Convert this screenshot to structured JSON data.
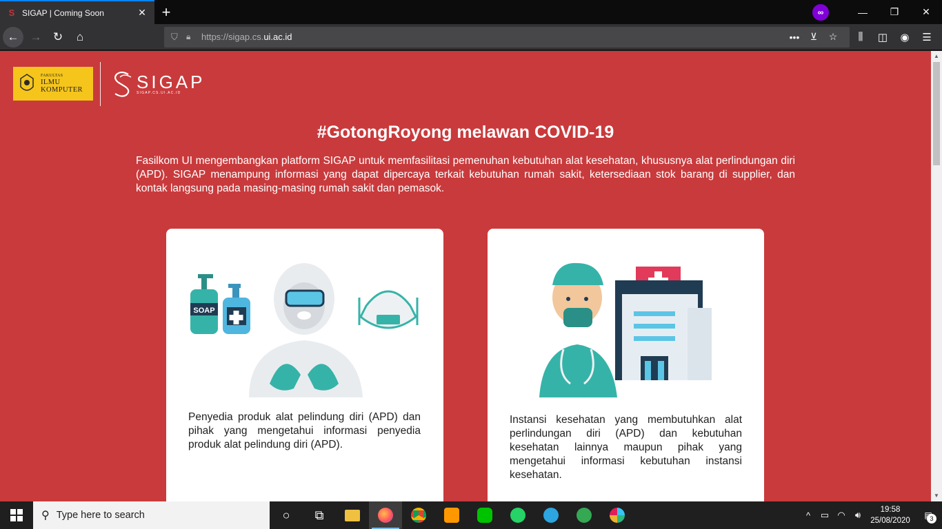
{
  "browser": {
    "tab_title": "SIGAP | Coming Soon",
    "url_prefix": "https://sigap.cs.",
    "url_domain": "ui.ac.id"
  },
  "logos": {
    "fasilkom_small": "FAKULTAS",
    "fasilkom_line1": "ILMU",
    "fasilkom_line2": "KOMPUTER",
    "sigap_word": "SIGAP",
    "sigap_sub": "SIGAP.CS.UI.AC.ID"
  },
  "main": {
    "headline": "#GotongRoyong melawan COVID-19",
    "intro": "Fasilkom UI mengembangkan platform SIGAP untuk memfasilitasi pemenuhan kebutuhan alat kesehatan, khususnya alat perlindungan diri (APD). SIGAP menampung informasi yang dapat dipercaya terkait kebutuhan rumah sakit, ketersediaan stok barang di supplier, dan kontak langsung pada masing-masing rumah sakit dan pemasok.",
    "cards": [
      {
        "text": "Penyedia produk alat pelindung diri (APD) dan pihak yang mengetahui informasi penyedia produk alat pelindung diri (APD)."
      },
      {
        "text": "Instansi kesehatan yang membutuhkan alat perlindungan diri (APD) dan kebutuhan kesehatan lainnya maupun pihak yang mengetahui informasi kebutuhan instansi kesehatan."
      }
    ]
  },
  "illustration_text": {
    "soap_label": "SOAP"
  },
  "taskbar": {
    "search_placeholder": "Type here to search",
    "time": "19:58",
    "date": "25/08/2020",
    "notification_count": "3"
  },
  "colors": {
    "page_background": "#c93a3c",
    "card_background": "#ffffff",
    "accent_teal": "#2bb3a6"
  }
}
